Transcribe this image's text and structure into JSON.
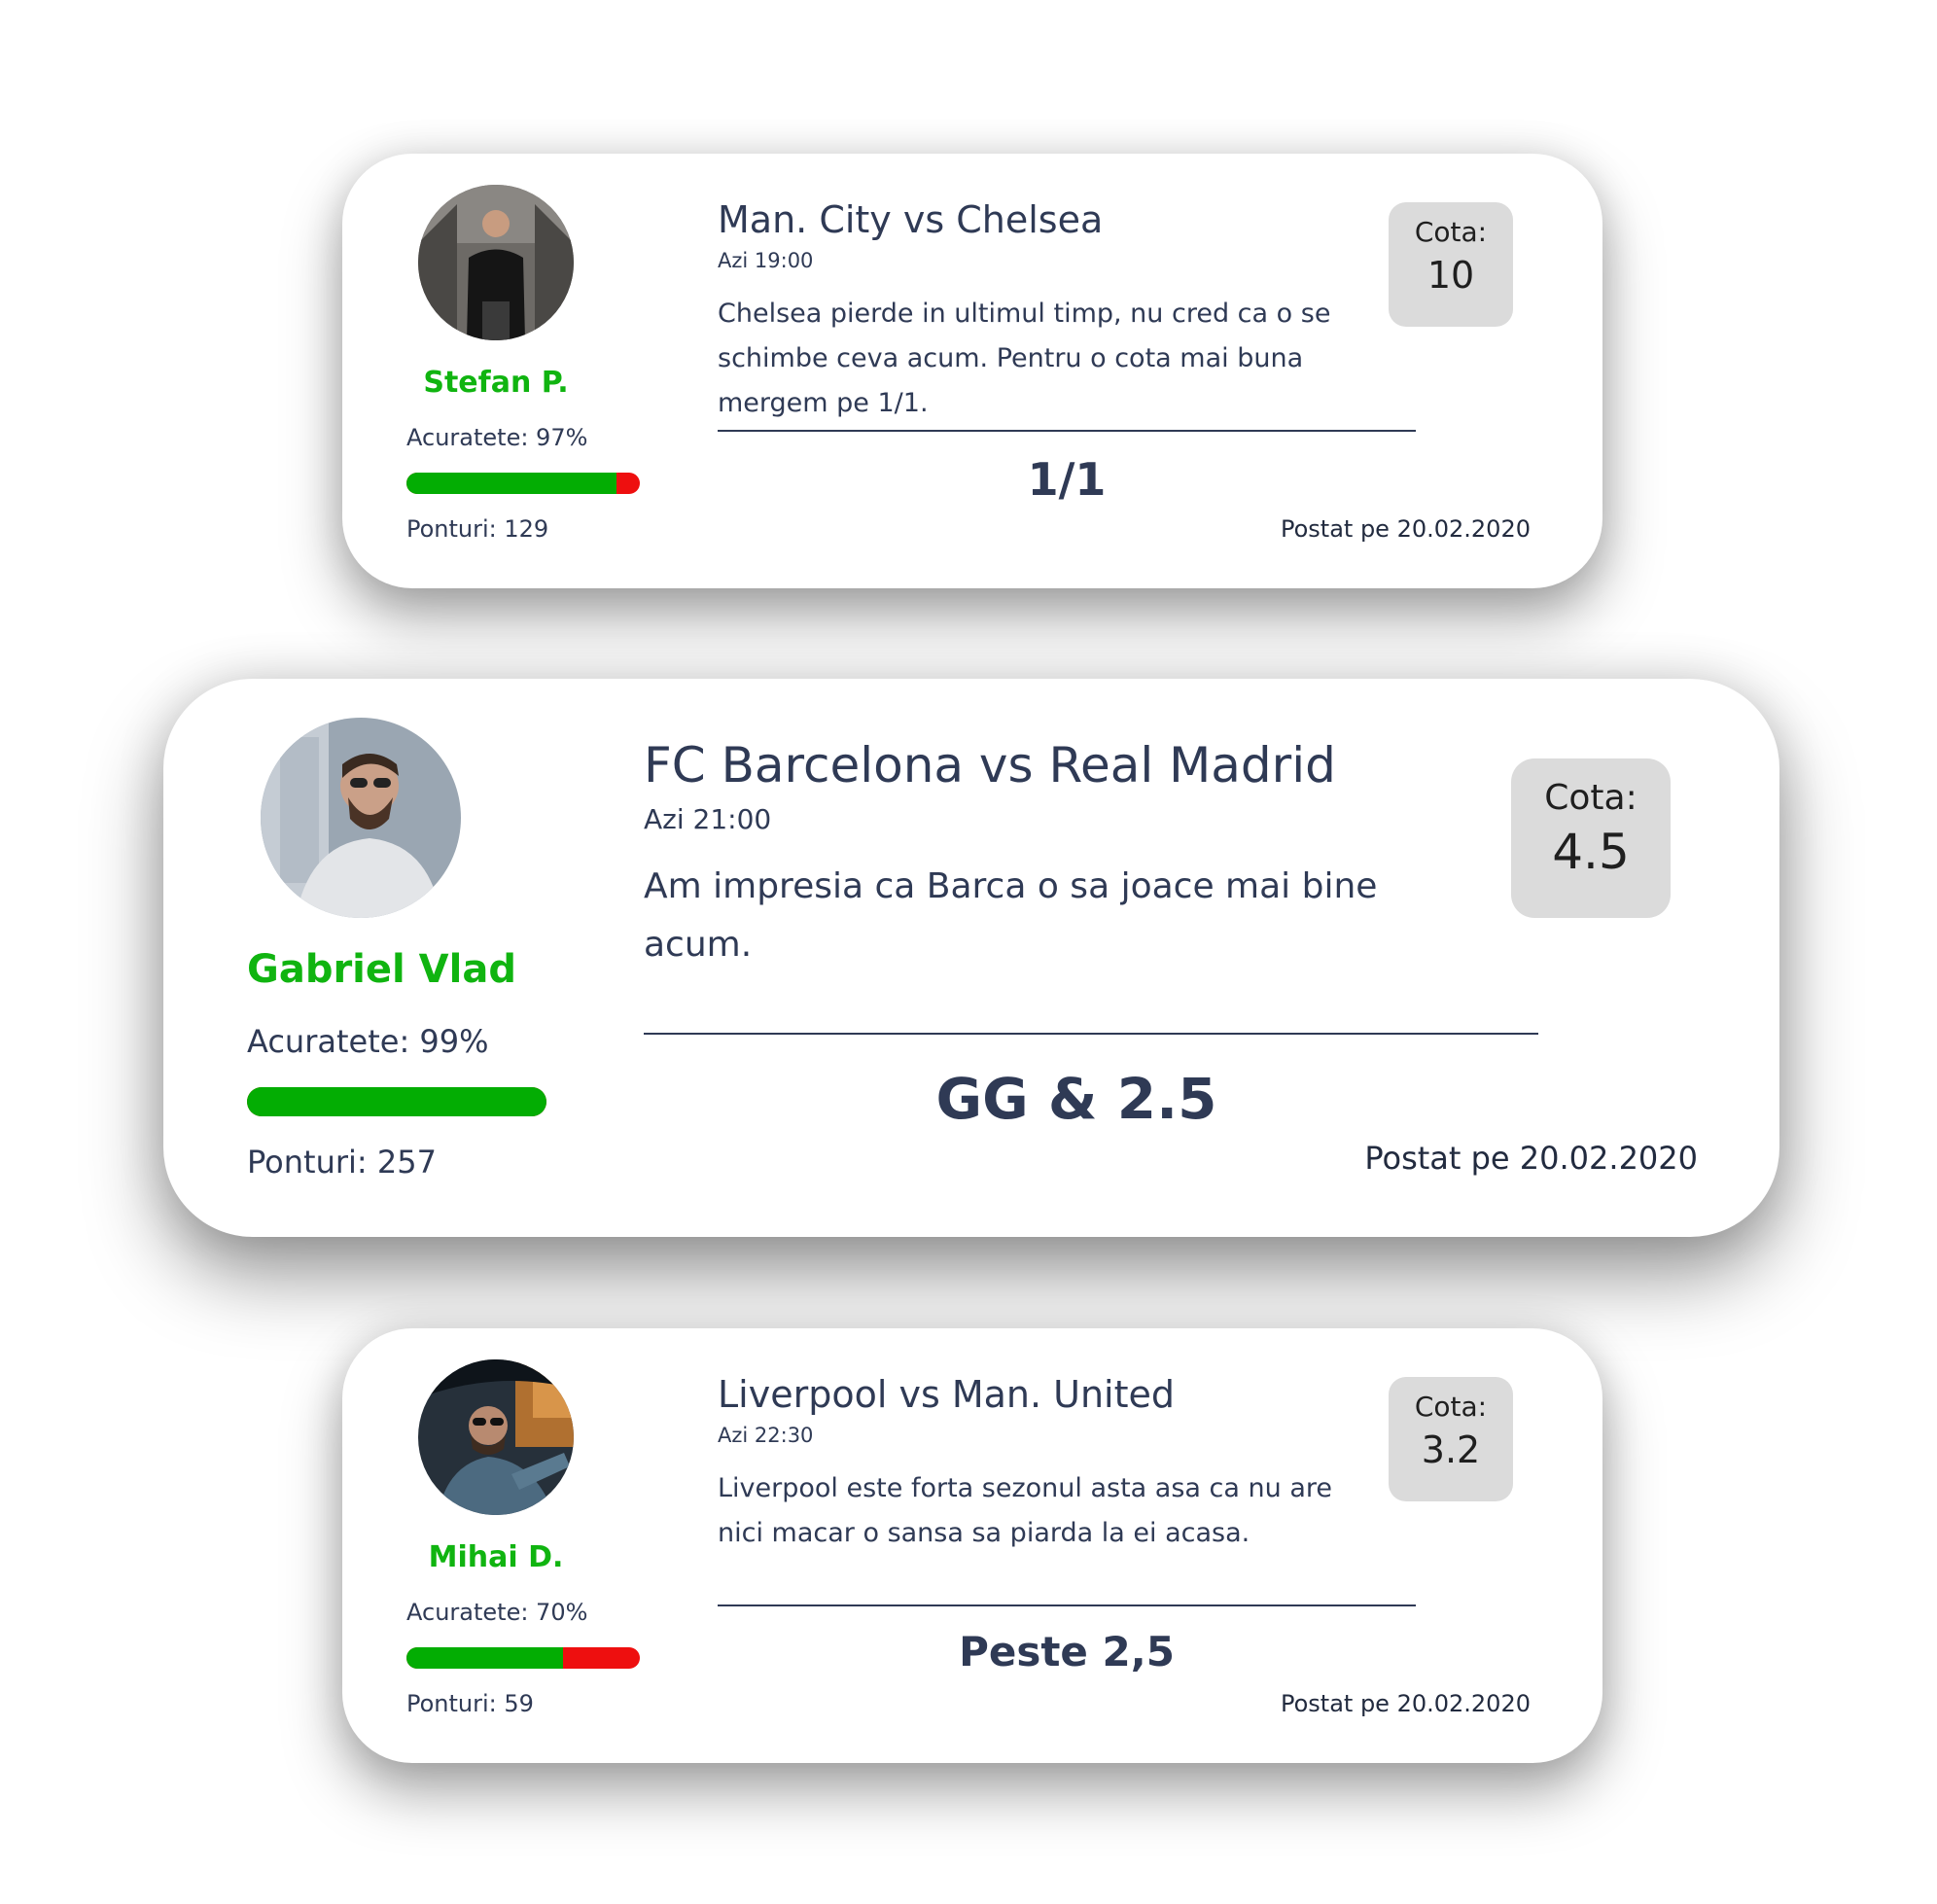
{
  "cards": [
    {
      "user": {
        "name": "Stefan P.",
        "accuracy": "Acuratete: 97%",
        "accuracy_value": 0.9,
        "tips": "Ponturi: 129",
        "avatar_icon": "user-avatar-photo"
      },
      "match": {
        "title": "Man. City vs Chelsea",
        "time": "Azi 19:00",
        "comment": "Chelsea pierde in ultimul timp, nu cred ca o se schimbe ceva acum. Pentru o cota mai buna mergem pe 1/1."
      },
      "prediction": "1/1",
      "odds": {
        "label": "Cota:",
        "value": "10"
      },
      "posted": "Postat pe 20.02.2020"
    },
    {
      "user": {
        "name": "Gabriel Vlad",
        "accuracy": "Acuratete: 99%",
        "accuracy_value": 1.0,
        "tips": "Ponturi: 257",
        "avatar_icon": "user-avatar-photo"
      },
      "match": {
        "title": "FC Barcelona vs Real Madrid",
        "time": "Azi 21:00",
        "comment": "Am impresia ca Barca o sa joace mai bine acum."
      },
      "prediction": "GG & 2.5",
      "odds": {
        "label": "Cota:",
        "value": "4.5"
      },
      "posted": "Postat pe 20.02.2020"
    },
    {
      "user": {
        "name": "Mihai D.",
        "accuracy": "Acuratete: 70%",
        "accuracy_value": 0.67,
        "tips": "Ponturi: 59",
        "avatar_icon": "user-avatar-photo"
      },
      "match": {
        "title": "Liverpool vs Man. United",
        "time": "Azi 22:30",
        "comment": "Liverpool este forta sezonul asta asa ca nu are nici macar o sansa sa piarda la ei acasa."
      },
      "prediction": "Peste 2,5",
      "odds": {
        "label": "Cota:",
        "value": "3.2"
      },
      "posted": "Postat pe 20.02.2020"
    }
  ],
  "colors": {
    "name_green": "#10b410",
    "bar_green": "#03ad03",
    "bar_red": "#ee0f0f",
    "odds_bg": "#dbdbdb",
    "text": "#2f3a55"
  }
}
